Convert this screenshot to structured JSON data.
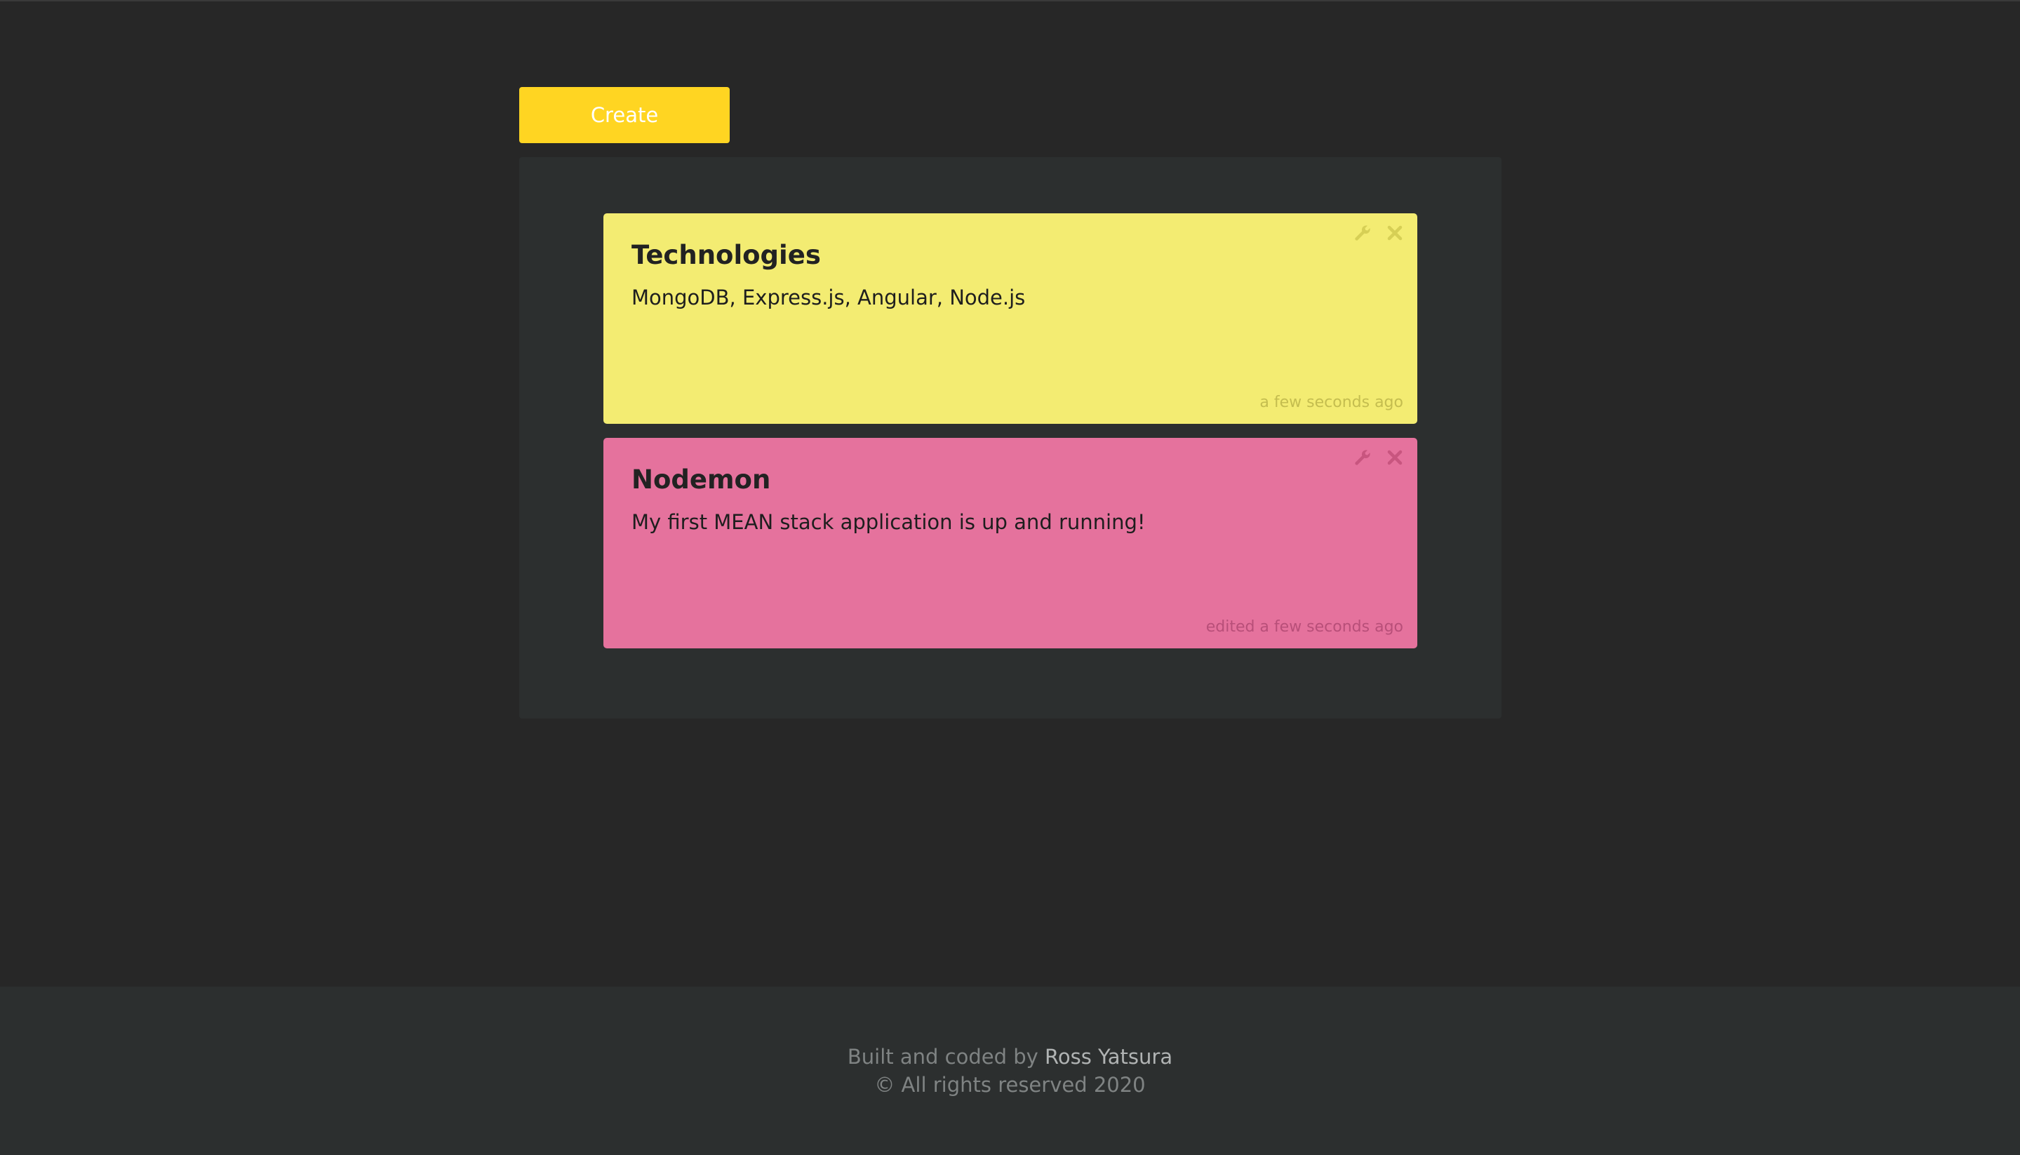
{
  "toolbar": {
    "create_label": "Create"
  },
  "notes": [
    {
      "title": "Technologies",
      "body": "MongoDB, Express.js, Angular, Node.js",
      "time": "a few seconds ago",
      "color": "#f3ec72",
      "icons": [
        "wrench-icon",
        "close-icon"
      ]
    },
    {
      "title": "Nodemon",
      "body": "My first MEAN stack application is up and running!",
      "time": "edited a few seconds ago",
      "color": "#e5729d",
      "icons": [
        "wrench-icon",
        "close-icon"
      ]
    }
  ],
  "footer": {
    "built_by_prefix": "Built and coded by ",
    "author": "Ross Yatsura",
    "copyright": "© All rights reserved 2020"
  },
  "colors": {
    "background": "#272727",
    "panel": "#2c2f2f",
    "accent": "#ffd522"
  }
}
